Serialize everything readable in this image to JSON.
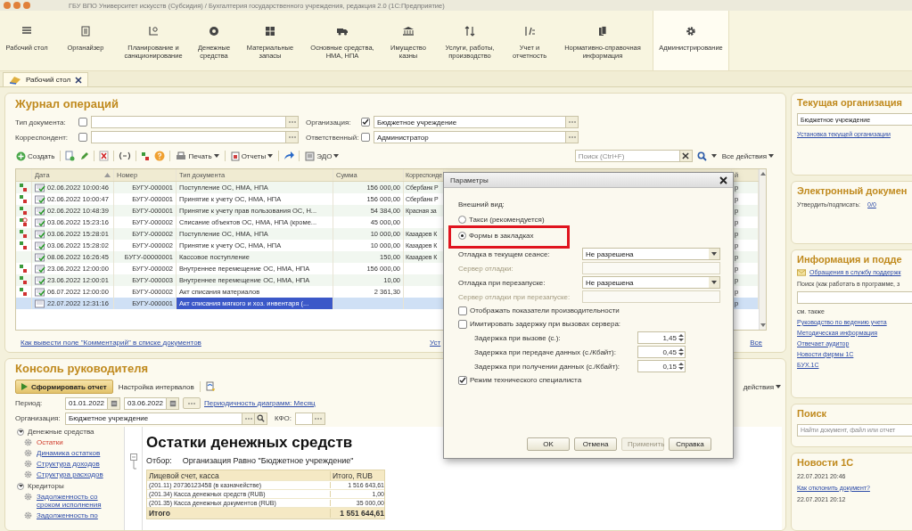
{
  "window": {
    "title": "ГБУ ВПО Университет искусств (Субсидия) / Бухгалтерия государственного учреждения, редакция 2.0 (1С:Предприятие)"
  },
  "sections": [
    {
      "label": "Рабочий стол",
      "selected": false
    },
    {
      "label": "Органайзер",
      "selected": false
    },
    {
      "label": "Планирование и санкционирование",
      "selected": false
    },
    {
      "label": "Денежные средства",
      "selected": false
    },
    {
      "label": "Материальные запасы",
      "selected": false
    },
    {
      "label": "Основные средства, НМА, НПА",
      "selected": false
    },
    {
      "label": "Имущество казны",
      "selected": false
    },
    {
      "label": "Услуги, работы, производство",
      "selected": false
    },
    {
      "label": "Учет и отчетность",
      "selected": false
    },
    {
      "label": "Нормативно-справочная информация",
      "selected": false
    },
    {
      "label": "Администрирование",
      "selected": true
    }
  ],
  "tabs": [
    {
      "label": "Рабочий стол",
      "selected": true
    }
  ],
  "journal": {
    "title": "Журнал операций",
    "filters": [
      {
        "label": "Тип документа:",
        "checked": false
      },
      {
        "label": "Организация:",
        "checked": true,
        "value": "Бюджетное учреждение"
      },
      {
        "label": "Корреспондент:",
        "checked": false
      },
      {
        "label": "Ответственный:",
        "checked": false,
        "value": "Администратор"
      }
    ],
    "toolbar": {
      "create": "Создать",
      "print": "Печать",
      "reports": "Отчеты",
      "edo": "ЭДО",
      "search_placeholder": "Поиск (Ctrl+F)",
      "all_actions": "Все действия"
    },
    "table": {
      "columns": [
        "Дата",
        "Номер",
        "Тип документа",
        "Сумма",
        "Корреспонде",
        "й"
      ],
      "rows": [
        {
          "kind": "posted",
          "conducted": true,
          "selected": false,
          "date": "02.06.2022 10:00:46",
          "number": "БУГУ-000001",
          "type": "Поступление ОС, НМА, НПА",
          "sum": "156 000,00",
          "corr": "Сбербанк Р",
          "column_6": "р"
        },
        {
          "kind": "posted",
          "conducted": true,
          "selected": false,
          "date": "02.06.2022 10:00:47",
          "number": "БУГУ-000001",
          "type": "Принятие к учету ОС, НМА, НПА",
          "sum": "156 000,00",
          "corr": "Сбербанк Р",
          "column_6": "р"
        },
        {
          "kind": "posted",
          "conducted": true,
          "selected": false,
          "date": "02.06.2022 10:48:39",
          "number": "БУГУ-000001",
          "type": "Принятие к учету прав пользования ОС, Н...",
          "sum": "54 384,00",
          "corr": "Красная за",
          "column_6": "р"
        },
        {
          "kind": "posted_changed",
          "conducted": true,
          "selected": false,
          "date": "03.06.2022 15:23:16",
          "number": "БУГУ-000002",
          "type": "Списание объектов ОС, НМА, НПА (кроме...",
          "sum": "45 000,00",
          "column_6": "р"
        },
        {
          "kind": "posted",
          "conducted": true,
          "selected": false,
          "date": "03.06.2022 15:28:01",
          "number": "БУГУ-000002",
          "type": "Поступление ОС, НМА, НПА",
          "sum": "10 000,00",
          "corr": "Казадоев К",
          "column_6": "р"
        },
        {
          "kind": "posted",
          "conducted": true,
          "selected": false,
          "date": "03.06.2022 15:28:02",
          "number": "БУГУ-000002",
          "type": "Принятие к учету ОС, НМА, НПА",
          "sum": "10 000,00",
          "corr": "Казадоев К",
          "column_6": "р"
        },
        {
          "kind": "plain",
          "conducted": true,
          "selected": false,
          "date": "08.06.2022 16:26:45",
          "number": "БУГУ-00000001",
          "type": "Кассовое поступление",
          "sum": "150,00",
          "corr": "Казадоев К",
          "column_6": "р"
        },
        {
          "kind": "posted",
          "conducted": true,
          "selected": false,
          "date": "23.06.2022 12:00:00",
          "number": "БУГУ-000002",
          "type": "Внутреннее перемещение ОС, НМА, НПА",
          "sum": "156 000,00",
          "column_6": "р"
        },
        {
          "kind": "posted",
          "conducted": true,
          "selected": false,
          "date": "23.06.2022 12:00:01",
          "number": "БУГУ-000003",
          "type": "Внутреннее перемещение ОС, НМА, НПА",
          "sum": "10,00",
          "column_6": "р"
        },
        {
          "kind": "posted",
          "conducted": true,
          "selected": false,
          "date": "06.07.2022 12:00:00",
          "number": "БУГУ-000002",
          "type": "Акт списания материалов",
          "sum": "2 361,30",
          "column_6": "р"
        },
        {
          "kind": "plain",
          "conducted": false,
          "selected": true,
          "date": "22.07.2022 12:31:16",
          "number": "БУГУ-000001",
          "type": "Акт списания мягкого и хоз. инвентаря (...",
          "column_6": "р"
        }
      ]
    },
    "comment_link": "Как вывести поле \"Комментарий\" в списке документов",
    "link_2": "Уст",
    "all_link": "Все"
  },
  "console": {
    "title": "Консоль руководителя",
    "generate": "Сформировать отчет",
    "intervals": "Настройка интервалов",
    "actions": "действия",
    "period_label": "Период:",
    "date_from": "01.01.2022",
    "date_to": "03.06.2022",
    "periodicity_link": "Периодичность диаграмм: Месяц",
    "org_label": "Организация:",
    "org_value": "Бюджетное учреждение",
    "kfo_label": "КФО:",
    "tree": [
      {
        "label": "Денежные средства",
        "expanded": true,
        "children": [
          {
            "label": "Остатки",
            "selected": true
          },
          {
            "label": "Динамика остатков",
            "selected": false
          },
          {
            "label": "Структура доходов",
            "selected": false
          },
          {
            "label": "Структура расходов",
            "selected": false
          }
        ]
      },
      {
        "label": "Кредиторы",
        "expanded": true,
        "children": [
          {
            "label": "Задолженность со сроком исполнения",
            "selected": false
          },
          {
            "label": "Задолженность по",
            "selected": false
          }
        ]
      }
    ],
    "report": {
      "title": "Остатки денежных средств",
      "filter_label": "Отбор:",
      "filter_value": "Организация Равно \"Бюджетное учреждение\"",
      "columns": [
        "Лицевой счет, касса",
        "Итого, RUB"
      ],
      "rows": [
        {
          "account": "(201.11) 20736123458 (в казначействе)",
          "total": "1 516 643,61"
        },
        {
          "account": "(201.34) Касса денежных средств (RUB)",
          "total": "1,00"
        },
        {
          "account": "(201.35) Касса денежных документов (RUB)",
          "total": "35 000,00"
        }
      ],
      "total": {
        "label": "Итого",
        "value": "1 551 644,61"
      }
    }
  },
  "current_org": {
    "title": "Текущая организация",
    "value": "Бюджетное учреждение",
    "link": "Установка текущей организации"
  },
  "edm": {
    "title": "Электронный докумен",
    "approve_label": "Утвердить/подписать:",
    "approve_link": "0/0"
  },
  "info": {
    "title": "Информация и подде",
    "support_link": "Обращения в службу поддержк",
    "search_label": "Поиск (как работать в программе, з",
    "see_also": "см. также",
    "links": [
      "Руководство по ведению учета",
      "Методическая информация",
      "Отвечает аудитор",
      "Новости фирмы 1С",
      "БУХ.1С"
    ]
  },
  "search": {
    "title": "Поиск",
    "placeholder": "Найти документ, файл или отчет"
  },
  "news": {
    "title": "Новости 1С",
    "entries": [
      {
        "kind": "date",
        "text": "22.07.2021 20:46"
      },
      {
        "kind": "link",
        "text": "Как отклонить документ?"
      },
      {
        "kind": "date",
        "text": "22.07.2021 20:12"
      }
    ]
  },
  "dialog": {
    "title": "Параметры",
    "appearance_label": "Внешний вид:",
    "options": [
      {
        "label": "Такси (рекомендуется)",
        "selected": false,
        "highlighted": false
      },
      {
        "label": "Формы в закладках",
        "selected": true,
        "highlighted": true
      }
    ],
    "fields": [
      {
        "kind": "select",
        "label": "Отладка в текущем сеансе:",
        "value": "Не разрешена",
        "disabled": false
      },
      {
        "kind": "text",
        "label": "Сервер отладки:",
        "disabled": true
      },
      {
        "kind": "select",
        "label": "Отладка при перезапуске:",
        "value": "Не разрешена",
        "disabled": false
      },
      {
        "kind": "text",
        "label": "Сервер отладки при перезапуске:",
        "disabled": true
      },
      {
        "kind": "checkbox",
        "label": "Отображать показатели производительности",
        "checked": false
      },
      {
        "kind": "checkbox",
        "label": "Имитировать задержку при вызовах сервера:",
        "checked": false
      },
      {
        "kind": "number",
        "label": "Задержка при вызове (с.):",
        "value": "1,45"
      },
      {
        "kind": "number",
        "label": "Задержка при передаче данных (с./Кбайт):",
        "value": "0,45"
      },
      {
        "kind": "number",
        "label": "Задержка при получении данных (с./Кбайт):",
        "value": "0,15"
      },
      {
        "kind": "checkbox",
        "label": "Режим технического специалиста",
        "checked": true
      }
    ],
    "buttons": [
      {
        "label": "OK",
        "disabled": false
      },
      {
        "label": "Отмена",
        "disabled": false
      },
      {
        "label": "Применить",
        "disabled": true
      },
      {
        "label": "Справка",
        "disabled": false
      }
    ]
  }
}
